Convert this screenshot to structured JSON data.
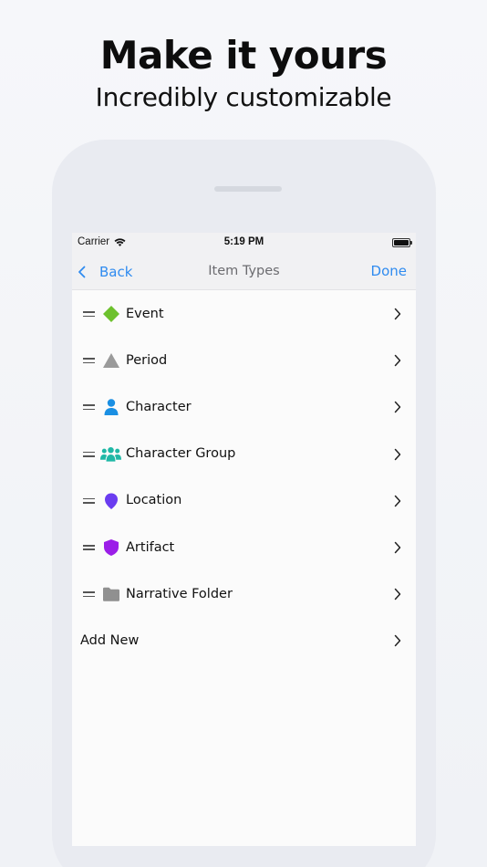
{
  "marketing": {
    "headline": "Make it yours",
    "subheadline": "Incredibly customizable"
  },
  "status_bar": {
    "carrier": "Carrier",
    "time": "5:19 PM"
  },
  "nav": {
    "back_label": "Back",
    "title": "Item Types",
    "done_label": "Done"
  },
  "items": [
    {
      "label": "Event",
      "icon": "diamond-icon",
      "color": "#6dc12d"
    },
    {
      "label": "Period",
      "icon": "triangle-icon",
      "color": "#9a9a9a"
    },
    {
      "label": "Character",
      "icon": "person-icon",
      "color": "#1a8fe3"
    },
    {
      "label": "Character Group",
      "icon": "group-icon",
      "color": "#1fb8a6"
    },
    {
      "label": "Location",
      "icon": "location-pin-icon",
      "color": "#6a3cf0"
    },
    {
      "label": "Artifact",
      "icon": "shield-icon",
      "color": "#9b1ee8"
    },
    {
      "label": "Narrative Folder",
      "icon": "folder-icon",
      "color": "#909090"
    }
  ],
  "add_new_label": "Add New",
  "colors": {
    "accent": "#2f8bf0",
    "nav_background": "#f1f1f3",
    "list_background": "#fbfbfb"
  }
}
